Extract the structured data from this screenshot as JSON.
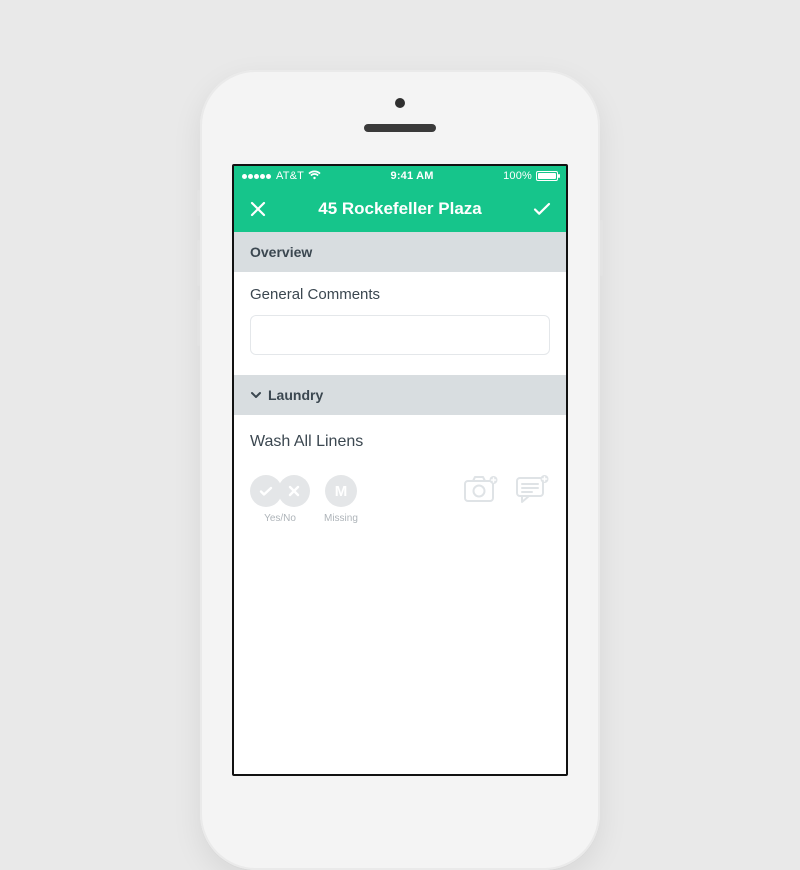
{
  "statusbar": {
    "carrier": "AT&T",
    "time": "9:41 AM",
    "battery_pct": "100%"
  },
  "navbar": {
    "title": "45 Rockefeller Plaza"
  },
  "sections": {
    "overview": {
      "header": "Overview",
      "comments_label": "General Comments",
      "comments_value": ""
    },
    "laundry": {
      "header": "Laundry",
      "task_title": "Wash All Linens",
      "yes_no_label": "Yes/No",
      "missing_label": "Missing",
      "missing_glyph": "M"
    }
  },
  "colors": {
    "accent": "#16c58b",
    "section_header_bg": "#d8dde0",
    "text": "#3b4750",
    "muted": "#aeb4b9",
    "chip_bg": "#e4e6e8"
  }
}
